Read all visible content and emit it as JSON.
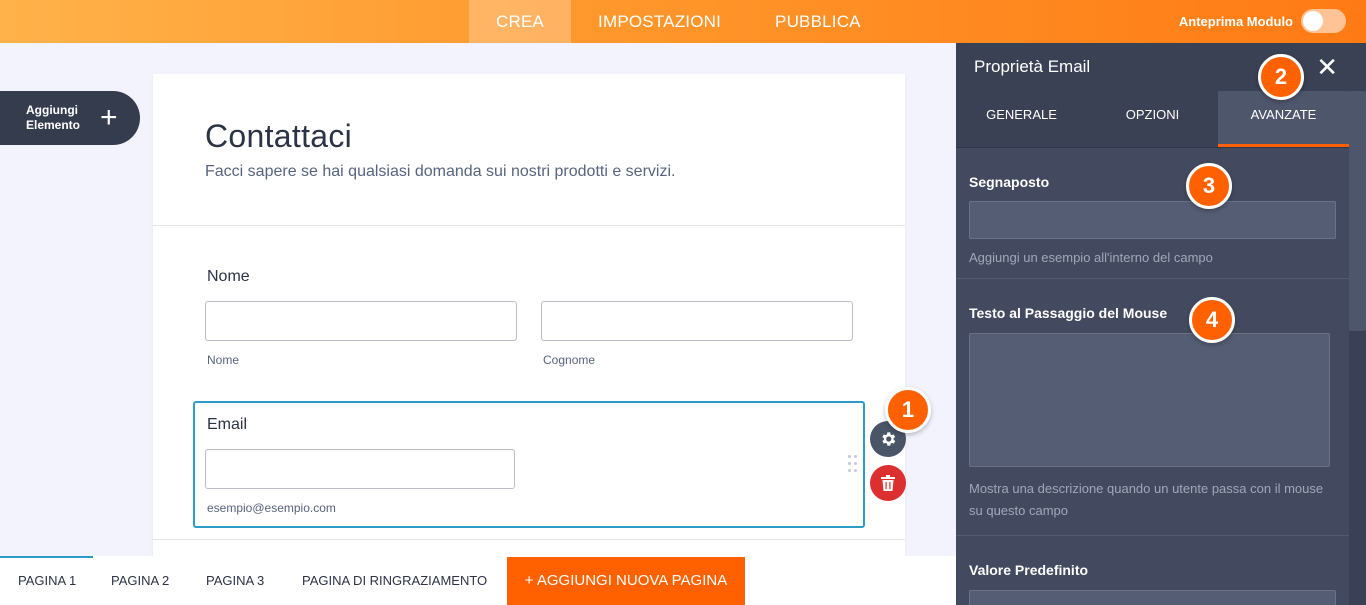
{
  "topbar": {
    "tabs": [
      "CREA",
      "IMPOSTAZIONI",
      "PUBBLICA"
    ],
    "preview_label": "Anteprima Modulo"
  },
  "sidebar": {
    "add_element_label": "Aggiungi Elemento"
  },
  "form": {
    "title": "Contattaci",
    "subtitle": "Facci sapere se hai qualsiasi domanda sui nostri prodotti e servizi.",
    "name_label": "Nome",
    "first_sublabel": "Nome",
    "last_sublabel": "Cognome",
    "email_label": "Email",
    "email_sublabel": "esempio@esempio.com"
  },
  "badges": [
    "1",
    "2",
    "3",
    "4"
  ],
  "pages": {
    "tabs": [
      "PAGINA 1",
      "PAGINA 2",
      "PAGINA 3",
      "PAGINA DI RINGRAZIAMENTO"
    ],
    "add_label": "+ AGGIUNGI NUOVA PAGINA"
  },
  "panel": {
    "title": "Proprietà Email",
    "tabs": [
      "GENERALE",
      "OPZIONI",
      "AVANZATE"
    ],
    "placeholder_title": "Segnaposto",
    "placeholder_hint": "Aggiungi un esempio all'interno del campo",
    "hover_title": "Testo al Passaggio del Mouse",
    "hover_hint": "Mostra una descrizione quando un utente passa con il mouse su questo campo",
    "default_title": "Valore Predefinito"
  },
  "colors": {
    "accent": "#ff6100",
    "panel": "#434a5f",
    "selected_border": "#2e9bc5"
  }
}
